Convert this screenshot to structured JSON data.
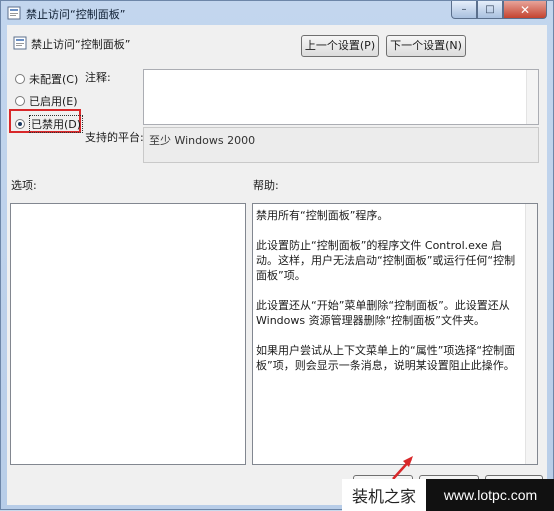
{
  "window": {
    "title": "禁止访问“控制面板”",
    "buttons": {
      "minimize": "–",
      "maximize": "□",
      "close": "✕"
    }
  },
  "header": {
    "title": "禁止访问“控制面板”",
    "prev_button": "上一个设置(P)",
    "next_button": "下一个设置(N)"
  },
  "state_options": [
    {
      "label": "未配置(C)",
      "checked": false
    },
    {
      "label": "已启用(E)",
      "checked": false
    },
    {
      "label": "已禁用(D)",
      "checked": true
    }
  ],
  "comment": {
    "label": "注释:",
    "value": ""
  },
  "platform": {
    "label": "支持的平台:",
    "value": "至少 Windows 2000"
  },
  "options": {
    "label": "选项:"
  },
  "help": {
    "label": "帮助:",
    "paragraphs": [
      "禁用所有“控制面板”程序。",
      "此设置防止“控制面板”的程序文件 Control.exe 启动。这样，用户无法启动“控制面板”或运行任何“控制面板”项。",
      "此设置还从“开始”菜单删除“控制面板”。此设置还从 Windows 资源管理器删除“控制面板”文件夹。",
      "如果用户尝试从上下文菜单上的“属性”项选择“控制面板”项，则会显示一条消息，说明某设置阻止此操作。"
    ]
  },
  "watermark": {
    "left_text": "装机之家",
    "right_text": "www.lotpc.com"
  },
  "colors": {
    "highlight": "#d8282a",
    "window_frame": "#b8cde8"
  }
}
